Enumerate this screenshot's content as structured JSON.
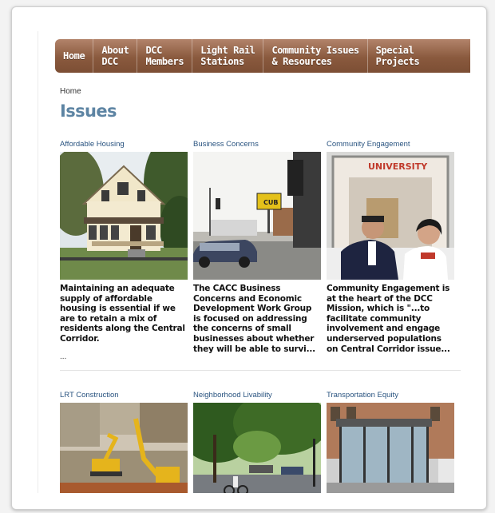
{
  "nav": {
    "items": [
      {
        "label": "Home"
      },
      {
        "label": "About\nDCC"
      },
      {
        "label": "DCC\nMembers"
      },
      {
        "label": "Light Rail\nStations"
      },
      {
        "label": "Community Issues\n& Resources"
      },
      {
        "label": "Special\nProjects"
      }
    ]
  },
  "breadcrumb": "Home",
  "page_title": "Issues",
  "cards": [
    {
      "title": "Affordable Housing",
      "desc": "Maintaining an adequate supply of affordable housing is essential if we are to retain a mix of residents along the Central Corridor.",
      "more": "..."
    },
    {
      "title": "Business Concerns",
      "desc": "The CACC Business Concerns and Economic Development Work Group is focused on addressing the concerns of small businesses about whether they will be able to survi...",
      "sign_text": "CUB"
    },
    {
      "title": "Community Engagement",
      "desc": "Community Engagement is at the heart of the DCC Mission, which is \"...to facilitate community involvement and engage underserved populations on Central Corridor issue...",
      "sign_text": "UNIVERSITY"
    },
    {
      "title": "LRT Construction"
    },
    {
      "title": "Neighborhood Livability"
    },
    {
      "title": "Transportation Equity"
    }
  ],
  "colors": {
    "nav_brown": "#8a5a3e",
    "title_blue": "#5d84a3",
    "link_blue": "#2a5480"
  }
}
